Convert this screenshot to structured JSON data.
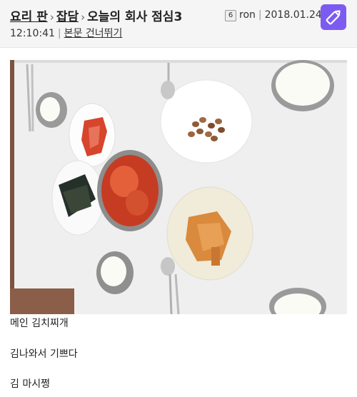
{
  "breadcrumb": {
    "board": "요리 판",
    "category": "잡담",
    "title": "오늘의 회사 점심3",
    "separator": "›"
  },
  "author": {
    "level_badge": "6",
    "name": "ron",
    "date": "2018.01.24"
  },
  "post": {
    "time": "12:10:41",
    "skip_link": "본문 건너뛰기",
    "lines": [
      "메인 김치찌개",
      "김나와서 기쁘다",
      "김 마시쩡"
    ]
  },
  "colors": {
    "accent": "#7c5cf0",
    "header_bg": "#f5f5f5",
    "table": "#efefef"
  },
  "icons": {
    "edit": "pencil-icon"
  }
}
